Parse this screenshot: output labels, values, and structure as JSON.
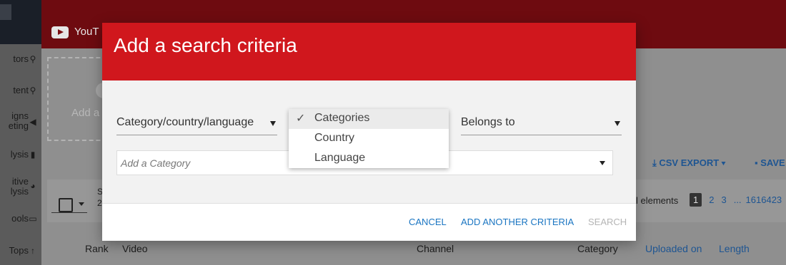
{
  "background": {
    "brand": "YouT",
    "add_box_text": "Add a",
    "sidebar_items": [
      {
        "label": "tors",
        "icon": "search-icon",
        "glyph": "⚲"
      },
      {
        "label": "tent",
        "icon": "search-icon",
        "glyph": "⚲"
      },
      {
        "label": "igns\neting",
        "icon": "megaphone-icon",
        "glyph": "◀"
      },
      {
        "label": "lysis",
        "icon": "bar-chart-icon",
        "glyph": "▮"
      },
      {
        "label": "itive\nlysis",
        "icon": "pie-chart-icon",
        "glyph": "◕"
      },
      {
        "label": "ools",
        "icon": "line-chart-icon",
        "glyph": "▭"
      },
      {
        "label": "Tops",
        "icon": "arrow-up-icon",
        "glyph": "↑"
      }
    ],
    "csv_export": "CSV EXPORT",
    "save": "SAVE",
    "elements_text": "l elements",
    "pager": [
      "1",
      "2",
      "3",
      "...",
      "1616423"
    ],
    "table_headers": [
      "Rank",
      "Video",
      "Channel",
      "Category",
      "Uploaded on",
      "Length"
    ],
    "panel_fragment_1": "S",
    "panel_fragment_2": "2"
  },
  "modal": {
    "title": "Add a search criteria",
    "criteria_select": "Category/country/language",
    "criteria_options": [
      "Categories",
      "Country",
      "Language"
    ],
    "selected_option": "Categories",
    "operator_select": "Belongs to",
    "category_placeholder": "Add a Category",
    "cancel": "CANCEL",
    "add_another": "ADD ANOTHER CRITERIA",
    "search": "SEARCH"
  },
  "colors": {
    "header_red": "#d0171d",
    "link_blue": "#1a75c2",
    "disabled": "#b5b5b5"
  }
}
